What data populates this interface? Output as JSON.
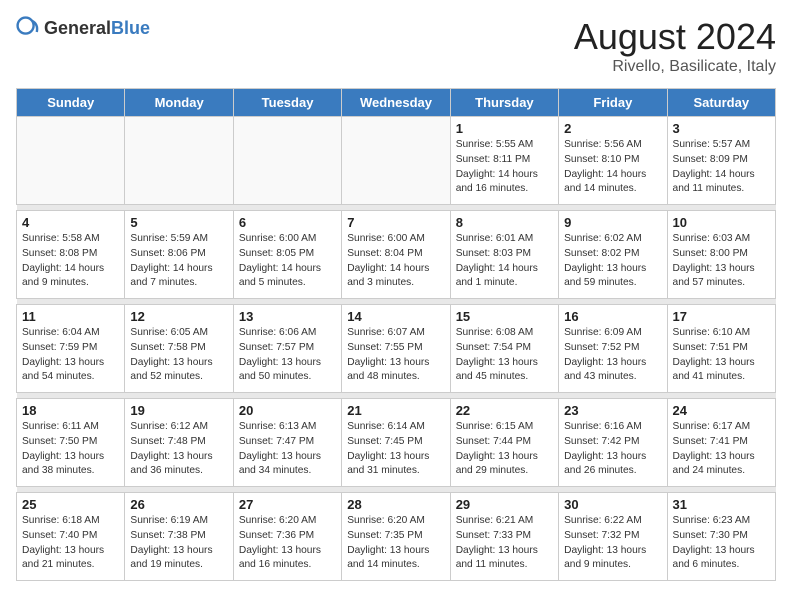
{
  "header": {
    "logo_general": "General",
    "logo_blue": "Blue",
    "month_year": "August 2024",
    "location": "Rivello, Basilicate, Italy"
  },
  "weekdays": [
    "Sunday",
    "Monday",
    "Tuesday",
    "Wednesday",
    "Thursday",
    "Friday",
    "Saturday"
  ],
  "weeks": [
    [
      {
        "day": "",
        "info": ""
      },
      {
        "day": "",
        "info": ""
      },
      {
        "day": "",
        "info": ""
      },
      {
        "day": "",
        "info": ""
      },
      {
        "day": "1",
        "info": "Sunrise: 5:55 AM\nSunset: 8:11 PM\nDaylight: 14 hours\nand 16 minutes."
      },
      {
        "day": "2",
        "info": "Sunrise: 5:56 AM\nSunset: 8:10 PM\nDaylight: 14 hours\nand 14 minutes."
      },
      {
        "day": "3",
        "info": "Sunrise: 5:57 AM\nSunset: 8:09 PM\nDaylight: 14 hours\nand 11 minutes."
      }
    ],
    [
      {
        "day": "4",
        "info": "Sunrise: 5:58 AM\nSunset: 8:08 PM\nDaylight: 14 hours\nand 9 minutes."
      },
      {
        "day": "5",
        "info": "Sunrise: 5:59 AM\nSunset: 8:06 PM\nDaylight: 14 hours\nand 7 minutes."
      },
      {
        "day": "6",
        "info": "Sunrise: 6:00 AM\nSunset: 8:05 PM\nDaylight: 14 hours\nand 5 minutes."
      },
      {
        "day": "7",
        "info": "Sunrise: 6:00 AM\nSunset: 8:04 PM\nDaylight: 14 hours\nand 3 minutes."
      },
      {
        "day": "8",
        "info": "Sunrise: 6:01 AM\nSunset: 8:03 PM\nDaylight: 14 hours\nand 1 minute."
      },
      {
        "day": "9",
        "info": "Sunrise: 6:02 AM\nSunset: 8:02 PM\nDaylight: 13 hours\nand 59 minutes."
      },
      {
        "day": "10",
        "info": "Sunrise: 6:03 AM\nSunset: 8:00 PM\nDaylight: 13 hours\nand 57 minutes."
      }
    ],
    [
      {
        "day": "11",
        "info": "Sunrise: 6:04 AM\nSunset: 7:59 PM\nDaylight: 13 hours\nand 54 minutes."
      },
      {
        "day": "12",
        "info": "Sunrise: 6:05 AM\nSunset: 7:58 PM\nDaylight: 13 hours\nand 52 minutes."
      },
      {
        "day": "13",
        "info": "Sunrise: 6:06 AM\nSunset: 7:57 PM\nDaylight: 13 hours\nand 50 minutes."
      },
      {
        "day": "14",
        "info": "Sunrise: 6:07 AM\nSunset: 7:55 PM\nDaylight: 13 hours\nand 48 minutes."
      },
      {
        "day": "15",
        "info": "Sunrise: 6:08 AM\nSunset: 7:54 PM\nDaylight: 13 hours\nand 45 minutes."
      },
      {
        "day": "16",
        "info": "Sunrise: 6:09 AM\nSunset: 7:52 PM\nDaylight: 13 hours\nand 43 minutes."
      },
      {
        "day": "17",
        "info": "Sunrise: 6:10 AM\nSunset: 7:51 PM\nDaylight: 13 hours\nand 41 minutes."
      }
    ],
    [
      {
        "day": "18",
        "info": "Sunrise: 6:11 AM\nSunset: 7:50 PM\nDaylight: 13 hours\nand 38 minutes."
      },
      {
        "day": "19",
        "info": "Sunrise: 6:12 AM\nSunset: 7:48 PM\nDaylight: 13 hours\nand 36 minutes."
      },
      {
        "day": "20",
        "info": "Sunrise: 6:13 AM\nSunset: 7:47 PM\nDaylight: 13 hours\nand 34 minutes."
      },
      {
        "day": "21",
        "info": "Sunrise: 6:14 AM\nSunset: 7:45 PM\nDaylight: 13 hours\nand 31 minutes."
      },
      {
        "day": "22",
        "info": "Sunrise: 6:15 AM\nSunset: 7:44 PM\nDaylight: 13 hours\nand 29 minutes."
      },
      {
        "day": "23",
        "info": "Sunrise: 6:16 AM\nSunset: 7:42 PM\nDaylight: 13 hours\nand 26 minutes."
      },
      {
        "day": "24",
        "info": "Sunrise: 6:17 AM\nSunset: 7:41 PM\nDaylight: 13 hours\nand 24 minutes."
      }
    ],
    [
      {
        "day": "25",
        "info": "Sunrise: 6:18 AM\nSunset: 7:40 PM\nDaylight: 13 hours\nand 21 minutes."
      },
      {
        "day": "26",
        "info": "Sunrise: 6:19 AM\nSunset: 7:38 PM\nDaylight: 13 hours\nand 19 minutes."
      },
      {
        "day": "27",
        "info": "Sunrise: 6:20 AM\nSunset: 7:36 PM\nDaylight: 13 hours\nand 16 minutes."
      },
      {
        "day": "28",
        "info": "Sunrise: 6:20 AM\nSunset: 7:35 PM\nDaylight: 13 hours\nand 14 minutes."
      },
      {
        "day": "29",
        "info": "Sunrise: 6:21 AM\nSunset: 7:33 PM\nDaylight: 13 hours\nand 11 minutes."
      },
      {
        "day": "30",
        "info": "Sunrise: 6:22 AM\nSunset: 7:32 PM\nDaylight: 13 hours\nand 9 minutes."
      },
      {
        "day": "31",
        "info": "Sunrise: 6:23 AM\nSunset: 7:30 PM\nDaylight: 13 hours\nand 6 minutes."
      }
    ]
  ]
}
